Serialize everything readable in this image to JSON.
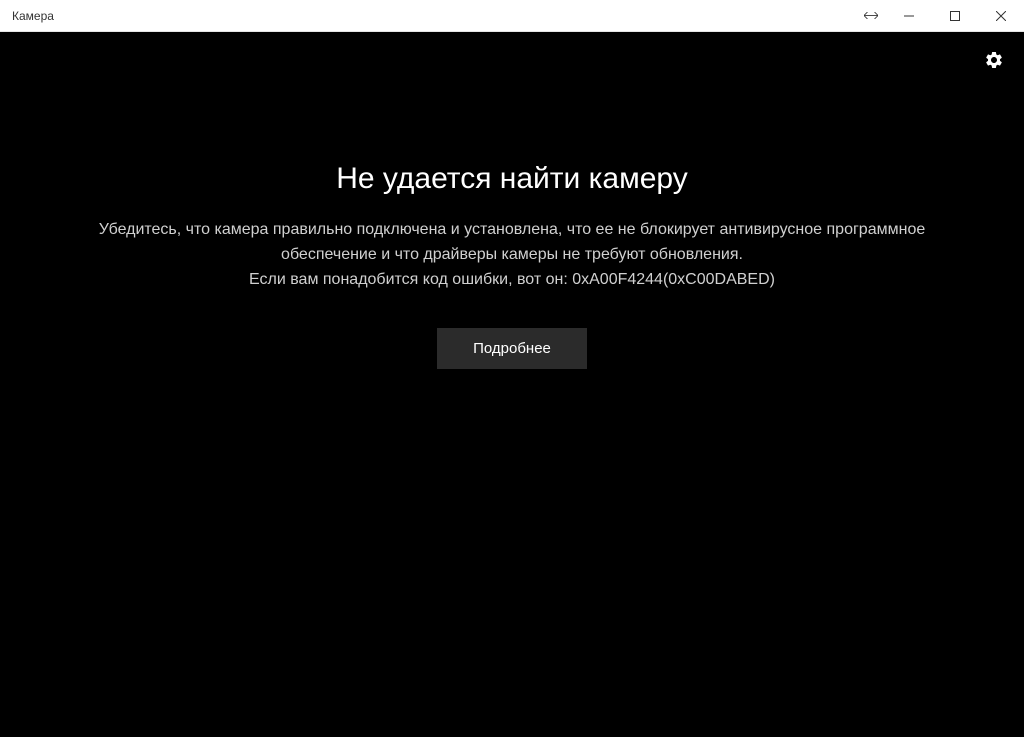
{
  "titlebar": {
    "title": "Камера"
  },
  "error": {
    "title": "Не удается найти камеру",
    "description": "Убедитесь, что камера правильно подключена и установлена, что ее не блокирует антивирусное программное обеспечение и что драйверы камеры не требуют обновления.",
    "code_line": "Если вам понадобится код ошибки, вот он: 0xA00F4244(0xC00DABED)",
    "details_button": "Подробнее"
  }
}
